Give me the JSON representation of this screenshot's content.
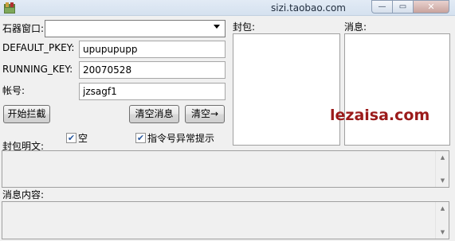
{
  "window": {
    "title": "sizi.taobao.com",
    "minimize_glyph": "—",
    "maximize_glyph": "▭",
    "close_glyph": "✕"
  },
  "form": {
    "game_window_label": "石器窗口:",
    "game_window_value": "",
    "default_pkey_label": "DEFAULT_PKEY:",
    "default_pkey_value": "upupupupp",
    "running_key_label": "RUNNING_KEY:",
    "running_key_value": "20070528",
    "account_label": "帐号:",
    "account_value": "jzsagf1"
  },
  "buttons": {
    "start_intercept": "开始拦截",
    "clear_messages": "清空消息",
    "clear_arrow": "清空→"
  },
  "options": {
    "packet_plaintext_label": "封包明文:",
    "empty_label": "空",
    "empty_checked": true,
    "cmd_error_label": "指令号异常提示",
    "cmd_error_checked": true
  },
  "panels": {
    "packet_label": "封包:",
    "message_label": "消息:"
  },
  "message_content_label": "消息内容:",
  "watermark": "lezaisa.com",
  "colors": {
    "titlebar": "#dbe6f3",
    "watermark": "#9b1a1a",
    "background": "#f0f0f0"
  }
}
